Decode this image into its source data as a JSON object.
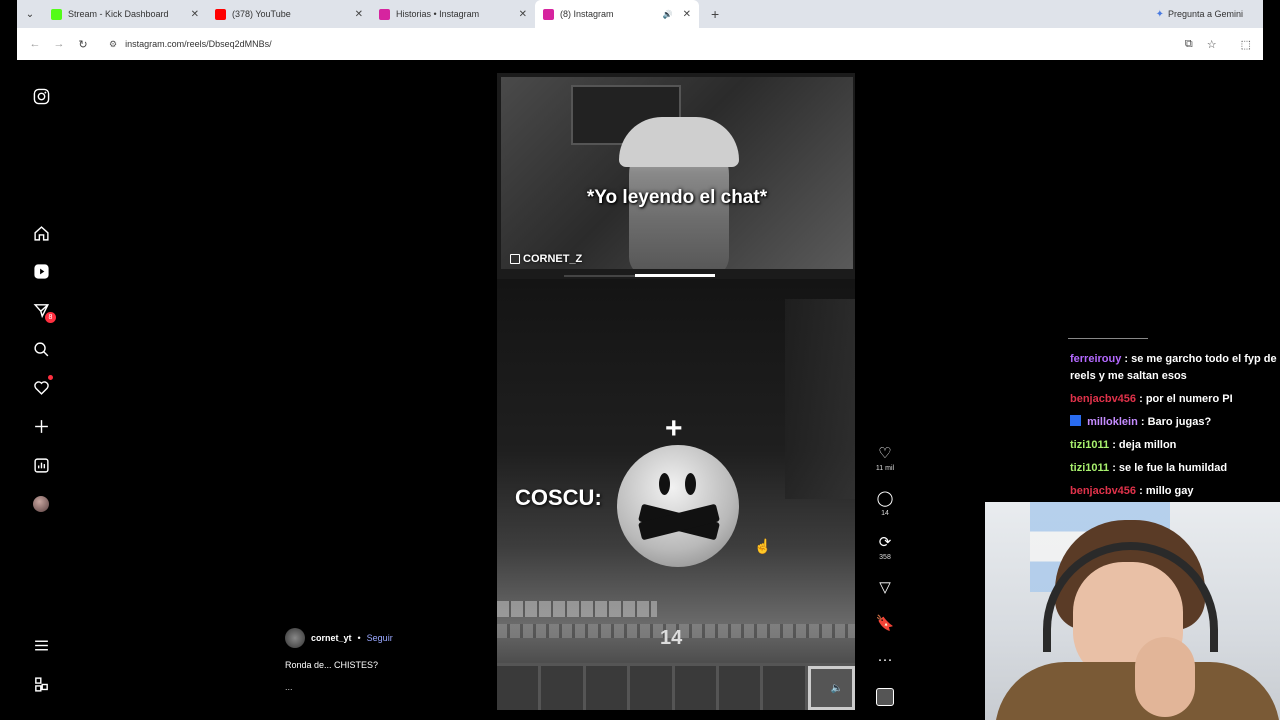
{
  "browser": {
    "tabs": [
      {
        "title": "Stream - Kick Dashboard",
        "favicon_color": "#53fc18"
      },
      {
        "title": "(378) YouTube",
        "favicon_color": "#ff0000"
      },
      {
        "title": "Historias • Instagram",
        "favicon_color": "#d6249f"
      },
      {
        "title": "(8) Instagram",
        "favicon_color": "#d6249f",
        "active": true
      }
    ],
    "gemini_label": "Pregunta a Gemini",
    "url": "instagram.com/reels/Dbseq2dMNBs/"
  },
  "sidebar": {
    "icons": [
      "instagram-logo-icon",
      "home-icon",
      "reels-icon",
      "messages-icon",
      "search-icon",
      "notifications-icon",
      "create-icon",
      "dashboard-icon",
      "profile-avatar",
      "menu-icon",
      "more-icon"
    ],
    "messages_badge": "8"
  },
  "reel": {
    "overlay_caption": "*Yo leyendo el chat*",
    "streamer_tag": "CORNET_Z",
    "coscu_label": "COSCU:",
    "hud_number": "14",
    "progress_fraction": 0.55
  },
  "actions": {
    "likes": "11 mil",
    "comments": "14",
    "reposts": "358"
  },
  "post": {
    "username": "cornet_yt",
    "separator": "•",
    "follow": "Seguir",
    "caption": "Ronda de... CHISTES?",
    "more": "..."
  },
  "chat": {
    "messages": [
      {
        "user": "ferreirouy",
        "text": ": se me garcho todo el fyp de reels y me saltan esos",
        "color": "#b469ff"
      },
      {
        "user": "benjacbv456",
        "text": ": por el numero PI",
        "color": "#e0324a"
      },
      {
        "user": "milloklein",
        "text": ": Baro jugas?",
        "color": "#c58cff",
        "badge": true
      },
      {
        "user": "tizi1011",
        "text": ": deja millon",
        "color": "#a8f06e"
      },
      {
        "user": "tizi1011",
        "text": ": se le fue la humildad",
        "color": "#a8f06e"
      },
      {
        "user": "benjacbv456",
        "text": ": millo gay",
        "color": "#e0324a"
      }
    ]
  }
}
